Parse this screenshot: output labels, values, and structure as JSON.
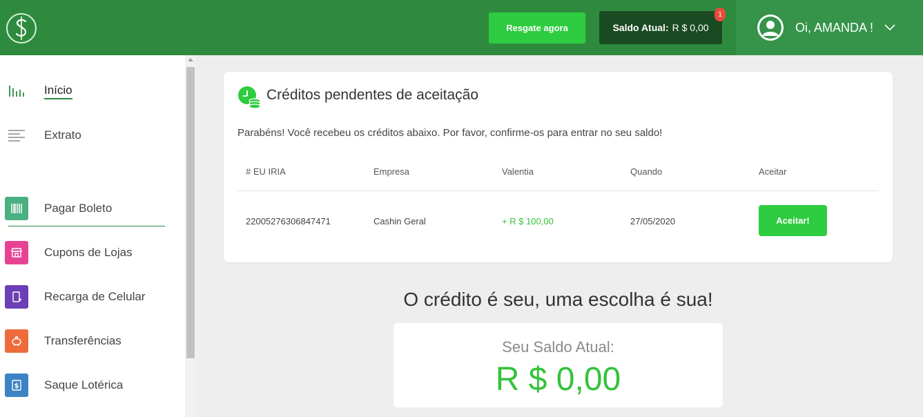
{
  "header": {
    "redeem_button": "Resgate agora",
    "balance_label": "Saldo Atual:",
    "balance_value": "R $ 0,00",
    "notification_count": "1",
    "greeting": "Oi, AMANDA !"
  },
  "sidebar": {
    "items": [
      {
        "label": "Início",
        "icon": "bar-chart-icon"
      },
      {
        "label": "Extrato",
        "icon": "list-icon"
      },
      {
        "label": "Pagar Boleto",
        "icon": "barcode-icon",
        "color": "#4caf81"
      },
      {
        "label": "Cupons de Lojas",
        "icon": "store-icon",
        "color": "#e84393"
      },
      {
        "label": "Recarga de Celular",
        "icon": "phone-icon",
        "color": "#6c3fb5"
      },
      {
        "label": "Transferências",
        "icon": "piggy-bank-icon",
        "color": "#ee6b3b"
      },
      {
        "label": "Saque Lotérica",
        "icon": "money-icon",
        "color": "#3b83c4"
      }
    ]
  },
  "pending": {
    "title": "Créditos pendentes de aceitação",
    "message": "Parabéns! Você recebeu os créditos abaixo. Por favor, confirme-os para entrar no seu saldo!",
    "columns": [
      "# EU IRIA",
      "Empresa",
      "Valentia",
      "Quando",
      "Aceitar"
    ],
    "rows": [
      {
        "id": "22005276306847471",
        "company": "Cashin Geral",
        "value": "+ R $ 100,00",
        "date": "27/05/2020",
        "action": "Aceitar!"
      }
    ]
  },
  "main": {
    "tagline": "O crédito é seu, uma escolha é sua!",
    "balance_label": "Seu Saldo Atual:",
    "balance_value": "R $ 0,00"
  },
  "colors": {
    "header": "#2e8b3e",
    "accent": "#2ecc40",
    "positive": "#35c23b"
  }
}
